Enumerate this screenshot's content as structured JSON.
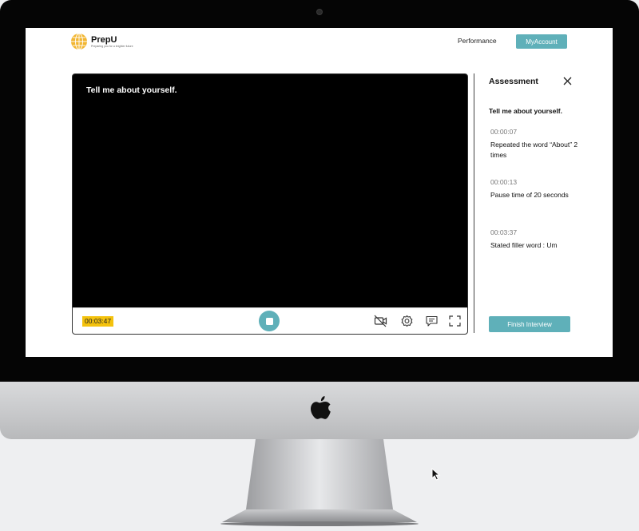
{
  "header": {
    "logo_name": "PrepU",
    "logo_tagline": "Preparing you for a brighter future",
    "nav_performance": "Performance",
    "account_label": "MyAccount"
  },
  "video": {
    "question": "Tell me about yourself.",
    "timer": "00:03:47"
  },
  "controls": {
    "icons": [
      "stop-icon",
      "camera-off-icon",
      "settings-icon",
      "captions-icon",
      "fullscreen-icon"
    ]
  },
  "assessment": {
    "title": "Assessment",
    "question": "Tell me about yourself.",
    "notes": [
      {
        "time": "00:00:07",
        "text": "Repeated the word “About” 2 times"
      },
      {
        "time": "00:00:13",
        "text": "Pause time of 20 seconds"
      },
      {
        "time": "00:03:37",
        "text": "Stated filler word : Um"
      }
    ],
    "finish_label": "Finish Interview"
  },
  "colors": {
    "accent": "#5fb0b9",
    "timer_highlight": "#f4c20d",
    "logo": "#f2b632"
  }
}
